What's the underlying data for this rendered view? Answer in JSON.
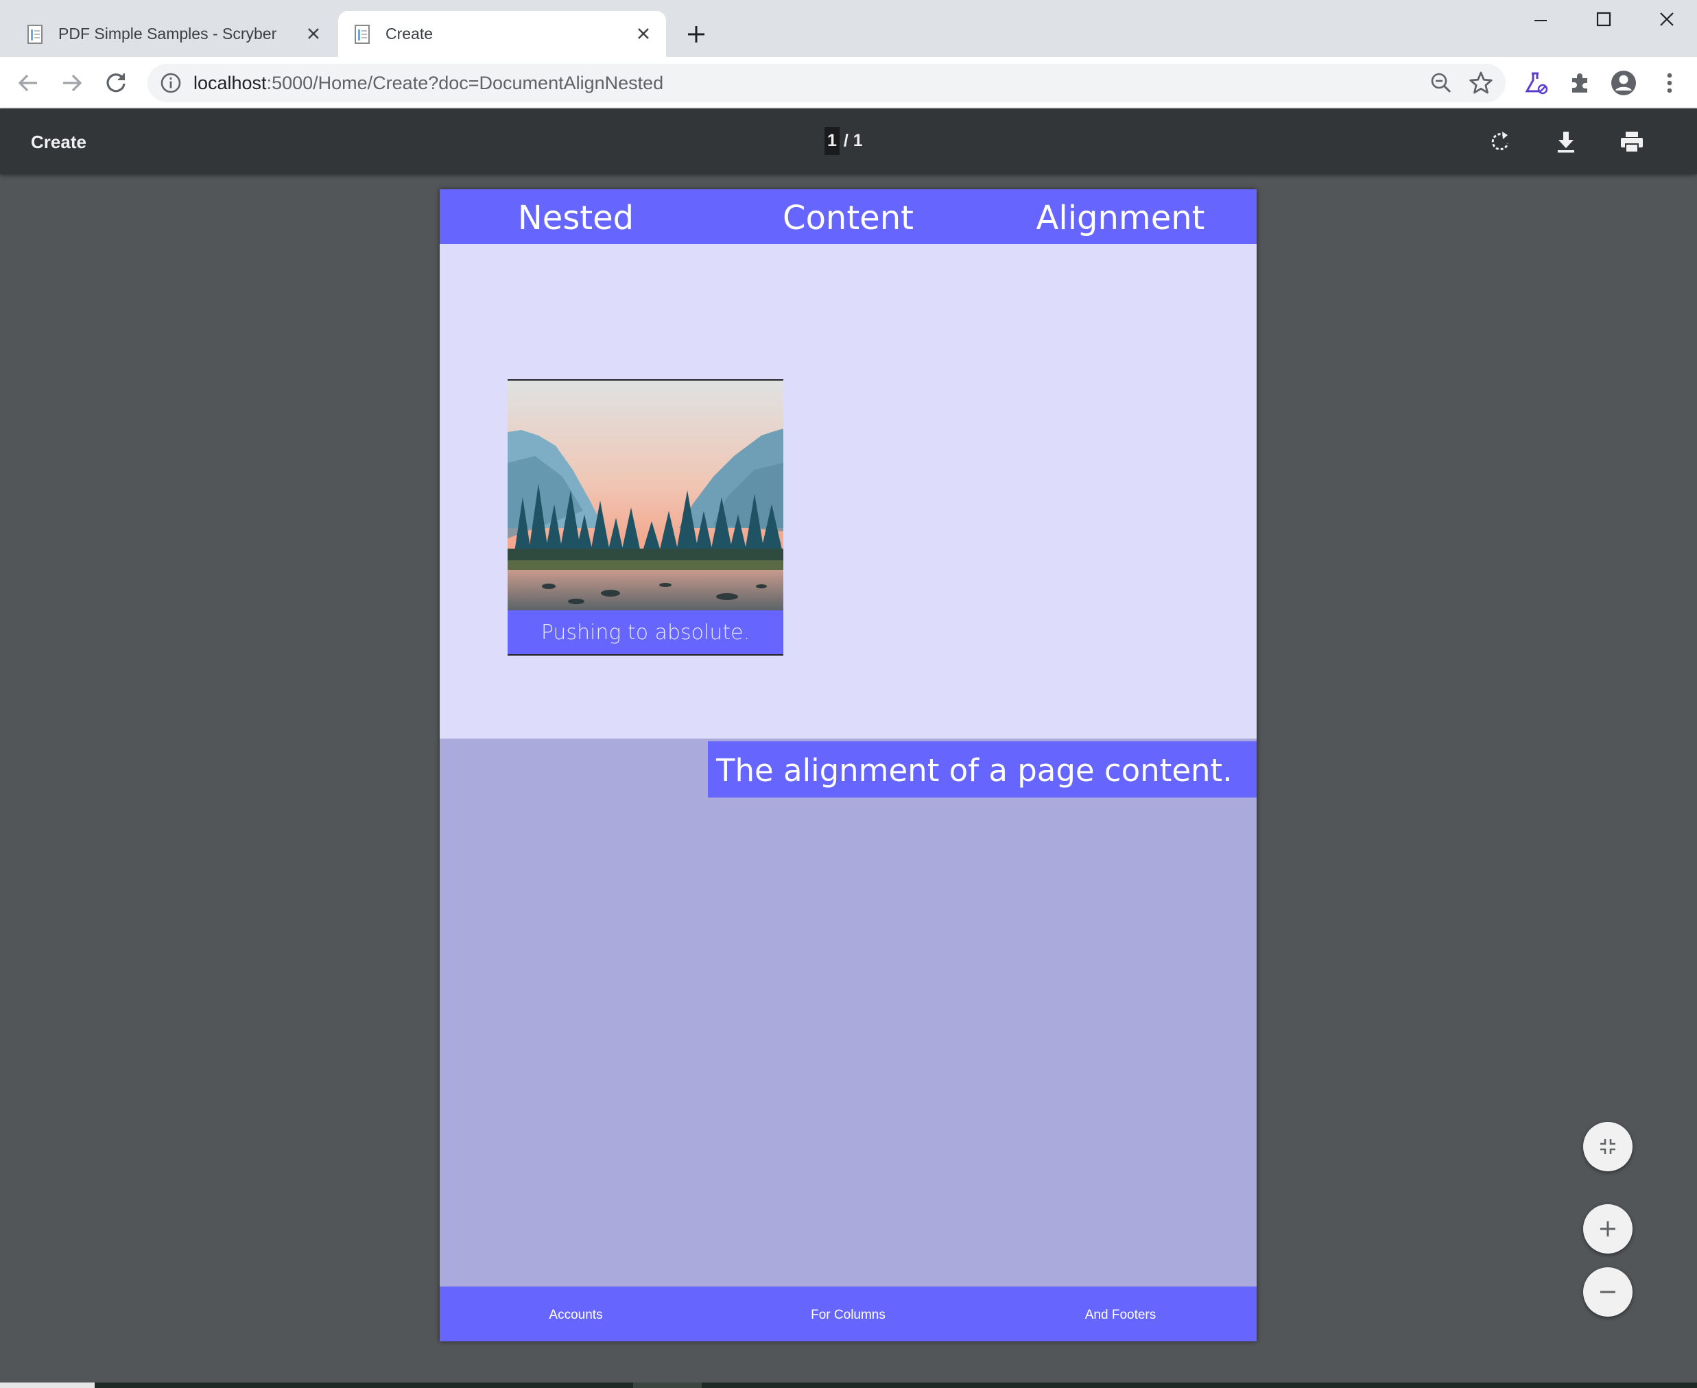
{
  "browser": {
    "tabs": [
      {
        "title": "PDF Simple Samples - Scryber",
        "active": false
      },
      {
        "title": "Create",
        "active": true
      }
    ],
    "url_host": "localhost",
    "url_path": ":5000/Home/Create?doc=DocumentAlignNested"
  },
  "viewer": {
    "title": "Create",
    "page_current": "1",
    "page_total": "/ 1"
  },
  "document": {
    "header": [
      "Nested",
      "Content",
      "Alignment"
    ],
    "image_caption": "Pushing to absolute.",
    "aligned_text": "The alignment of a page content.",
    "footer": [
      "Accounts",
      "For Columns",
      "And Footers"
    ],
    "colors": {
      "accent": "#6666ff",
      "region_light": "#ddddfb",
      "region_mid": "#aaaadd"
    }
  },
  "icons": [
    "back-icon",
    "forward-icon",
    "reload-icon",
    "info-icon",
    "zoom-out-icon",
    "star-icon",
    "labs-icon",
    "extensions-icon",
    "profile-icon",
    "menu-icon",
    "rotate-icon",
    "download-icon",
    "print-icon",
    "fit-page-icon",
    "zoom-in-icon",
    "zoom-out-icon"
  ]
}
